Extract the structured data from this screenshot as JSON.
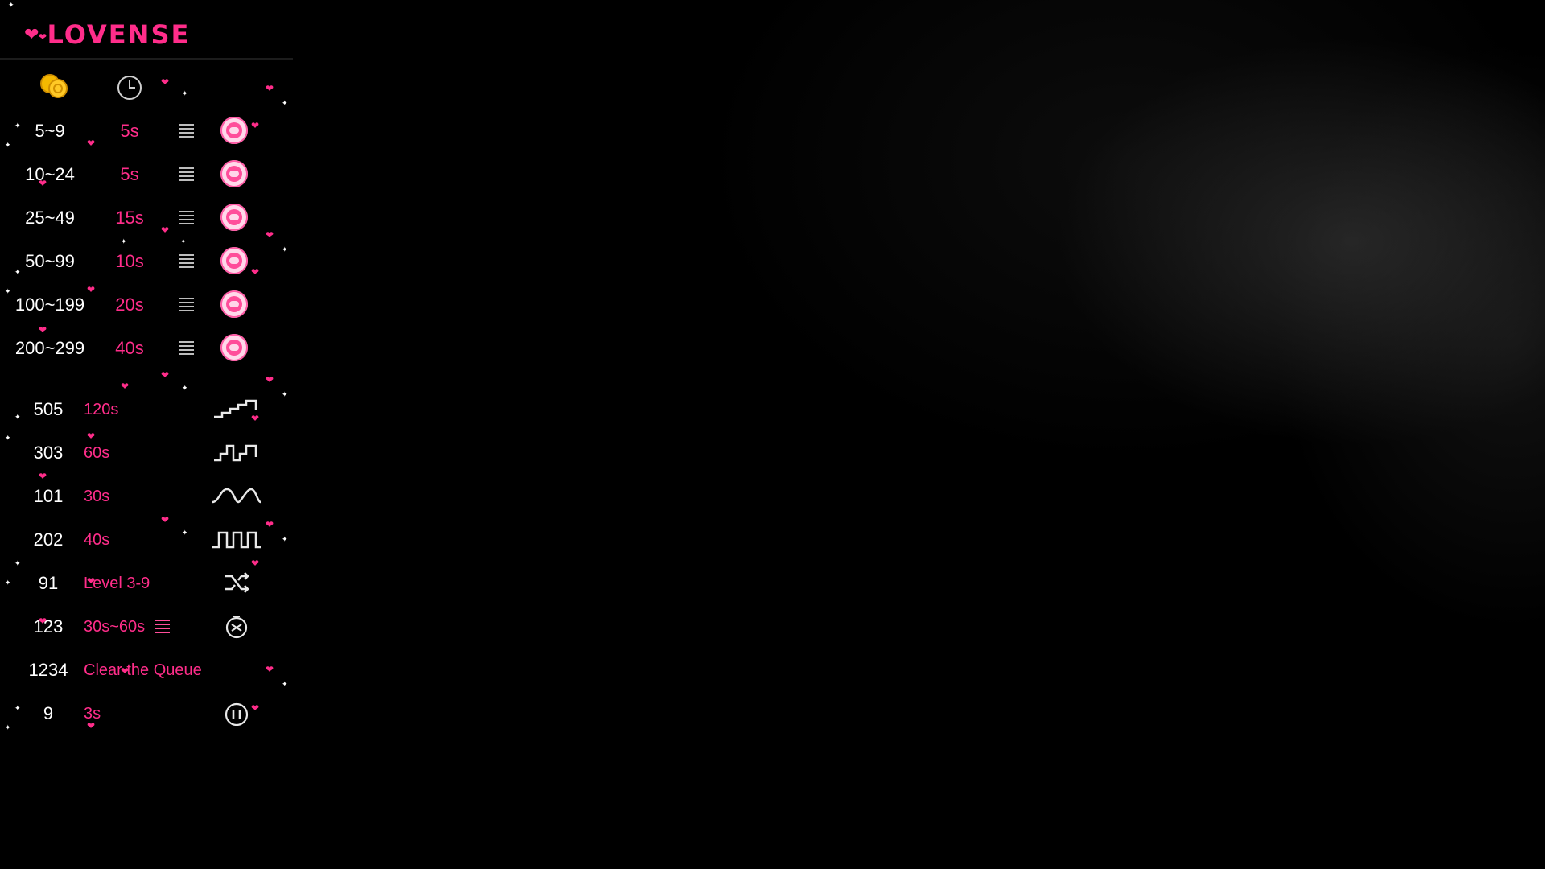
{
  "brand": {
    "name": "LOVENSE"
  },
  "header": {
    "coin_icon": "coins-icon",
    "time_icon": "clock-icon"
  },
  "levels": [
    {
      "amount": "5~9",
      "duration": "5s"
    },
    {
      "amount": "10~24",
      "duration": "5s"
    },
    {
      "amount": "25~49",
      "duration": "15s"
    },
    {
      "amount": "50~99",
      "duration": "10s"
    },
    {
      "amount": "100~199",
      "duration": "20s"
    },
    {
      "amount": "200~299",
      "duration": "40s"
    }
  ],
  "specials": [
    {
      "amount": "505",
      "label": "120s",
      "icon": "staircase-pattern-icon"
    },
    {
      "amount": "303",
      "label": "60s",
      "icon": "step-wave-pattern-icon"
    },
    {
      "amount": "101",
      "label": "30s",
      "icon": "wave-pattern-icon"
    },
    {
      "amount": "202",
      "label": "40s",
      "icon": "pulse-pattern-icon"
    },
    {
      "amount": "91",
      "label": "Level 3-9",
      "icon": "random-icon"
    },
    {
      "amount": "123",
      "label": "30s~60s",
      "icon": "random-timer-icon"
    },
    {
      "amount": "1234",
      "label": "Clear the Queue",
      "icon": ""
    },
    {
      "amount": "9",
      "label": "3s",
      "icon": "pause-icon"
    }
  ],
  "colors": {
    "accent": "#ff2d8a",
    "background": "#000000",
    "text": "#ffffff"
  }
}
